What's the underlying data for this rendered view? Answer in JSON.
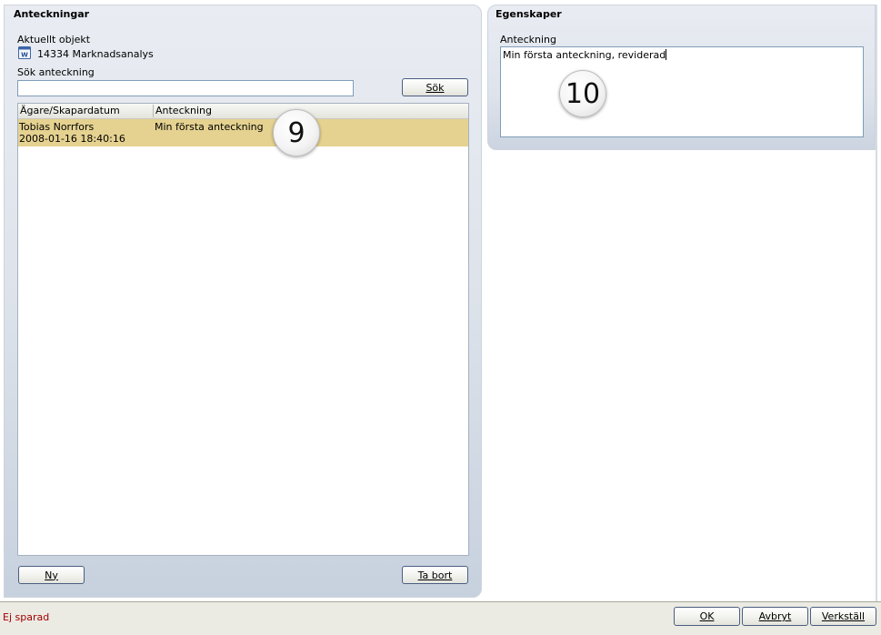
{
  "notes_panel": {
    "title": "Anteckningar",
    "current_object_label": "Aktuellt objekt",
    "current_object_value": "14334  Marknadsanalys",
    "search_label": "Sök anteckning",
    "search_value": "",
    "search_button": "Sök",
    "search_button_mnemonic": "S",
    "columns": [
      "Ägare/Skapardatum",
      "Anteckning"
    ],
    "rows": [
      {
        "owner": "Tobias Norrfors",
        "date": "2008-01-16 18:40:16",
        "note": "Min första anteckning"
      }
    ],
    "new_button": "Ny",
    "delete_button": "Ta bort"
  },
  "properties_panel": {
    "title": "Egenskaper",
    "note_label": "Anteckning",
    "note_value": "Min första anteckning, reviderad"
  },
  "callouts": [
    "9",
    "10"
  ],
  "status": {
    "text": "Ej sparad",
    "color": "#a00000"
  },
  "dialog_buttons": {
    "ok": "OK",
    "cancel": "Avbryt",
    "apply": "Verkställ"
  },
  "colors": {
    "selected_row": "#e5d290",
    "panel_bg": "#dfe4ec"
  }
}
